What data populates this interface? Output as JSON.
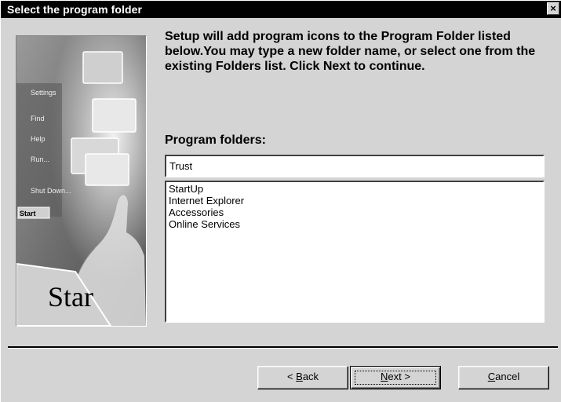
{
  "window": {
    "title": "Select the program folder",
    "close_glyph": "×"
  },
  "instructions": "Setup will add program icons to the Program Folder listed below.You may type a new folder name, or select one from the existing Folders list. Click Next to continue.",
  "folders_label": "Program folders:",
  "folder_input_value": "Trust",
  "folders": [
    "StartUp",
    "Internet Explorer",
    "Accessories",
    "Online Services"
  ],
  "side_image": {
    "menu_items": [
      "Settings",
      "Find",
      "Help",
      "Run...",
      "Shut Down..."
    ],
    "start_label": "Start",
    "start_big": "Star"
  },
  "buttons": {
    "back_prefix": "< ",
    "back_key": "B",
    "back_rest": "ack",
    "next_key": "N",
    "next_rest": "ext >",
    "cancel_key": "C",
    "cancel_rest": "ancel"
  }
}
